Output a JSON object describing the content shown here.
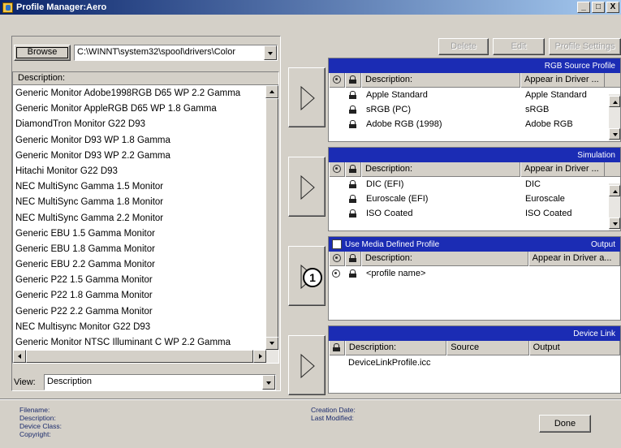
{
  "window": {
    "title": "Profile Manager:Aero",
    "minimize": "_",
    "maximize": "□",
    "close": "X"
  },
  "browse": {
    "label": "Browse",
    "path": "C:\\WINNT\\system32\\spool\\drivers\\Color"
  },
  "list": {
    "header": "Description:",
    "items": [
      "Generic Monitor Adobe1998RGB D65 WP 2.2 Gamma",
      "Generic Monitor AppleRGB D65 WP 1.8 Gamma",
      "DiamondTron Monitor G22 D93",
      "Generic Monitor D93 WP 1.8 Gamma",
      "Generic Monitor D93 WP 2.2 Gamma",
      "Hitachi Monitor G22 D93",
      "NEC MultiSync Gamma 1.5 Monitor",
      "NEC MultiSync Gamma 1.8 Monitor",
      "NEC MultiSync Gamma 2.2 Monitor",
      "Generic EBU 1.5 Gamma Monitor",
      "Generic EBU 1.8 Gamma Monitor",
      "Generic EBU 2.2 Gamma Monitor",
      "Generic P22 1.5 Gamma Monitor",
      "Generic P22 1.8 Gamma Monitor",
      "Generic P22 2.2 Gamma Monitor",
      "NEC Multisync Monitor G22 D93",
      "Generic Monitor NTSC Illuminant C WP 2.2 Gamma"
    ]
  },
  "view": {
    "label": "View:",
    "value": "Description"
  },
  "actions": {
    "delete": "Delete",
    "edit": "Edit",
    "settings": "Profile Settings"
  },
  "rgb": {
    "title": "RGB Source Profile",
    "col_desc": "Description:",
    "col_appear": "Appear in Driver ...",
    "rows": [
      {
        "desc": "Apple Standard",
        "appear": "Apple Standard"
      },
      {
        "desc": "sRGB (PC)",
        "appear": "sRGB"
      },
      {
        "desc": "Adobe RGB (1998)",
        "appear": "Adobe RGB"
      }
    ]
  },
  "simulation": {
    "title": "Simulation",
    "col_desc": "Description:",
    "col_appear": "Appear in Driver ...",
    "rows": [
      {
        "desc": "DIC (EFI)",
        "appear": "DIC"
      },
      {
        "desc": "Euroscale (EFI)",
        "appear": "Euroscale"
      },
      {
        "desc": "ISO Coated",
        "appear": "ISO Coated"
      }
    ]
  },
  "output": {
    "checkbox_label": "Use Media Defined Profile",
    "title": "Output",
    "col_desc": "Description:",
    "col_appear": "Appear in Driver a...",
    "rows": [
      {
        "desc": "<profile name>"
      }
    ]
  },
  "device_link": {
    "title": "Device Link",
    "col_desc": "Description:",
    "col_source": "Source",
    "col_output": "Output",
    "rows": [
      {
        "desc": "DeviceLinkProfile.icc"
      }
    ]
  },
  "callout": "1",
  "footer": {
    "filename": "Filename:",
    "description": "Description:",
    "device_class": "Device Class:",
    "copyright": "Copyright:",
    "creation_date": "Creation Date:",
    "last_modified": "Last Modified:",
    "done": "Done"
  }
}
